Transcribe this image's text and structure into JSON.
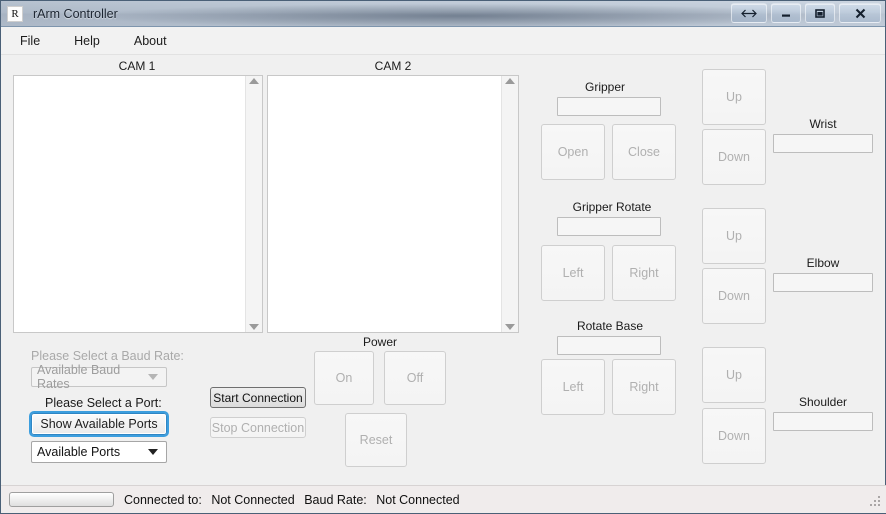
{
  "window": {
    "icon_letter": "R",
    "title": "rArm Controller",
    "controls": [
      {
        "name": "restore-arrows-button",
        "glyph": "restore"
      },
      {
        "name": "minimize-button",
        "glyph": "minimize"
      },
      {
        "name": "maximize-button",
        "glyph": "maximize"
      },
      {
        "name": "close-button",
        "glyph": "close"
      }
    ]
  },
  "menubar": {
    "items": [
      {
        "label": "File"
      },
      {
        "label": "Help"
      },
      {
        "label": "About"
      }
    ]
  },
  "cameras": [
    {
      "title": "CAM 1"
    },
    {
      "title": "CAM 2"
    }
  ],
  "serial": {
    "baud_label": "Please Select a Baud Rate:",
    "baud_combo_value": "Available Baud Rates",
    "baud_enabled": false,
    "port_label": "Please Select a Port:",
    "show_ports_button": "Show Available Ports",
    "port_combo_value": "Available Ports",
    "start_connection_button": "Start Connection",
    "stop_connection_button": "Stop Connection",
    "start_enabled": true,
    "stop_enabled": false
  },
  "power": {
    "title": "Power",
    "on_button": "On",
    "off_button": "Off",
    "reset_button": "Reset",
    "enabled": false
  },
  "controls": {
    "gripper": {
      "title": "Gripper",
      "value": "",
      "left_button": "Open",
      "right_button": "Close",
      "enabled": false
    },
    "gripper_rotate": {
      "title": "Gripper Rotate",
      "value": "",
      "left_button": "Left",
      "right_button": "Right",
      "enabled": false
    },
    "rotate_base": {
      "title": "Rotate Base",
      "value": "",
      "left_button": "Left",
      "right_button": "Right",
      "enabled": false
    }
  },
  "joints": [
    {
      "name": "Wrist",
      "up_button": "Up",
      "down_button": "Down",
      "value": "",
      "enabled": false
    },
    {
      "name": "Elbow",
      "up_button": "Up",
      "down_button": "Down",
      "value": "",
      "enabled": false
    },
    {
      "name": "Shoulder",
      "up_button": "Up",
      "down_button": "Down",
      "value": "",
      "enabled": false
    }
  ],
  "statusbar": {
    "progress_percent": 0,
    "connected_to_label": "Connected to:",
    "connected_to_value": "Not Connected",
    "baud_rate_label": "Baud Rate:",
    "baud_rate_value": "Not Connected"
  },
  "colors": {
    "window_bg": "#f0f0f0",
    "accent_focus": "#3c9ede",
    "statusbar_bg": "#f0ecec",
    "disabled_text": "#b0b0b0"
  }
}
